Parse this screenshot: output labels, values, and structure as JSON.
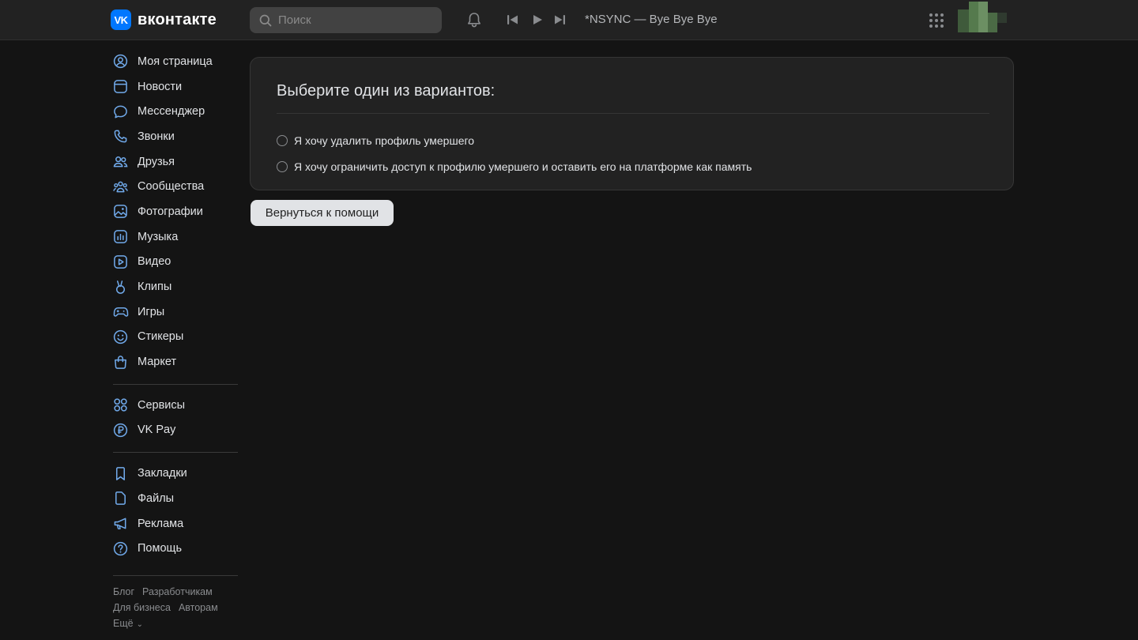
{
  "header": {
    "logo_mark": "VK",
    "logo_text": "вконтакте",
    "search_placeholder": "Поиск",
    "now_playing": "*NSYNC — Bye Bye Bye"
  },
  "sidebar": {
    "items": [
      {
        "label": "Моя страница",
        "icon": "user-circle-icon"
      },
      {
        "label": "Новости",
        "icon": "news-icon"
      },
      {
        "label": "Мессенджер",
        "icon": "message-icon"
      },
      {
        "label": "Звонки",
        "icon": "phone-icon"
      },
      {
        "label": "Друзья",
        "icon": "friends-icon"
      },
      {
        "label": "Сообщества",
        "icon": "communities-icon"
      },
      {
        "label": "Фотографии",
        "icon": "photo-icon"
      },
      {
        "label": "Музыка",
        "icon": "music-icon"
      },
      {
        "label": "Видео",
        "icon": "video-icon"
      },
      {
        "label": "Клипы",
        "icon": "clips-icon"
      },
      {
        "label": "Игры",
        "icon": "gamepad-icon"
      },
      {
        "label": "Стикеры",
        "icon": "smile-icon"
      },
      {
        "label": "Маркет",
        "icon": "bag-icon"
      }
    ],
    "items2": [
      {
        "label": "Сервисы",
        "icon": "services-icon"
      },
      {
        "label": "VK Pay",
        "icon": "ruble-icon"
      }
    ],
    "items3": [
      {
        "label": "Закладки",
        "icon": "bookmark-icon"
      },
      {
        "label": "Файлы",
        "icon": "file-icon"
      },
      {
        "label": "Реклама",
        "icon": "megaphone-icon"
      },
      {
        "label": "Помощь",
        "icon": "help-icon"
      }
    ],
    "footer": {
      "blog": "Блог",
      "developers": "Разработчикам",
      "business": "Для бизнеса",
      "authors": "Авторам",
      "more": "Ещё"
    }
  },
  "main": {
    "title": "Выберите один из вариантов:",
    "options": [
      "Я хочу удалить профиль умершего",
      "Я хочу ограничить доступ к профилю умершего и оставить его на платформе как память"
    ],
    "back_button": "Вернуться к помощи"
  },
  "colors": {
    "background": "#141414",
    "header": "#222222",
    "card": "#222222",
    "brand": "#0077ff",
    "text": "#e1e3e6",
    "muted": "#8a8c8f"
  }
}
